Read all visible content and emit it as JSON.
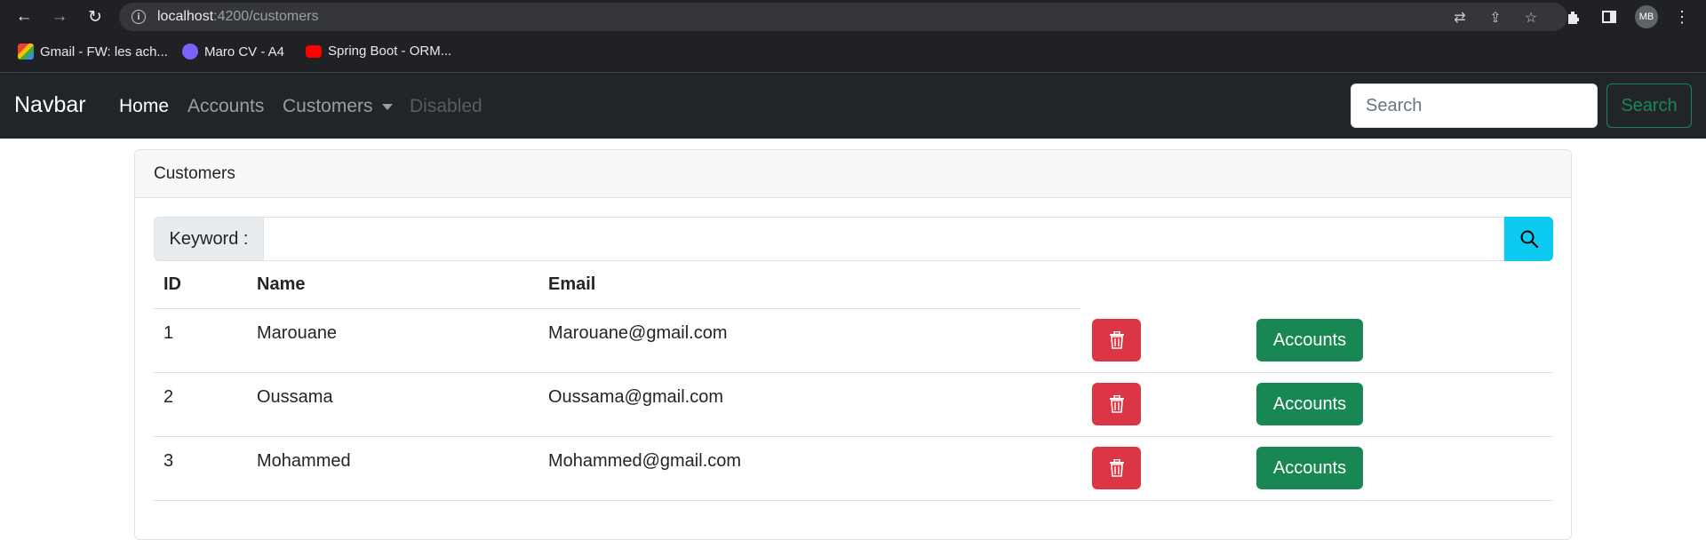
{
  "browser": {
    "url_host": "localhost",
    "url_rest": ":4200/customers",
    "profile_initials": "MB",
    "bookmarks": [
      {
        "label": "Gmail - FW: les ach...",
        "icon": "gmail-icon"
      },
      {
        "label": "Maro CV - A4",
        "icon": "document-icon"
      },
      {
        "label": "Spring Boot - ORM...",
        "icon": "youtube-icon"
      }
    ]
  },
  "navbar": {
    "brand": "Navbar",
    "links": [
      {
        "label": "Home",
        "state": "active"
      },
      {
        "label": "Accounts",
        "state": "normal"
      },
      {
        "label": "Customers",
        "state": "dropdown"
      },
      {
        "label": "Disabled",
        "state": "disabled"
      }
    ],
    "search_placeholder": "Search",
    "search_button": "Search"
  },
  "card": {
    "title": "Customers",
    "keyword_label": "Keyword :",
    "keyword_value": ""
  },
  "table": {
    "headers": [
      "ID",
      "Name",
      "Email"
    ],
    "rows": [
      {
        "id": "1",
        "name": "Marouane",
        "email": "Marouane@gmail.com",
        "action": "Accounts"
      },
      {
        "id": "2",
        "name": "Oussama",
        "email": "Oussama@gmail.com",
        "action": "Accounts"
      },
      {
        "id": "3",
        "name": "Mohammed",
        "email": "Mohammed@gmail.com",
        "action": "Accounts"
      }
    ]
  },
  "colors": {
    "navbar_bg": "#212529",
    "danger": "#dc3545",
    "success": "#198754",
    "info": "#0dcaf0"
  }
}
